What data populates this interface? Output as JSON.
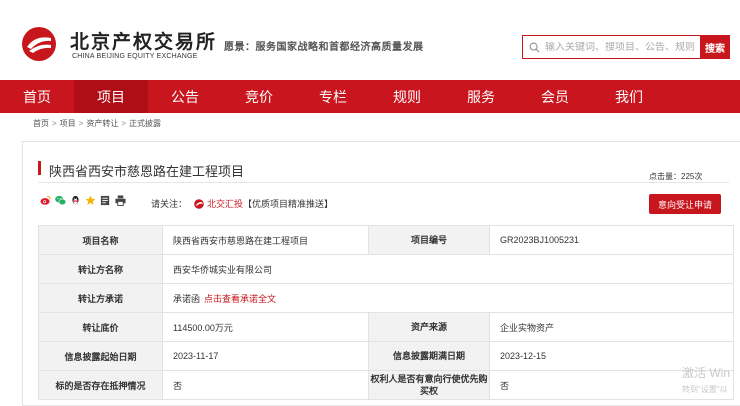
{
  "header": {
    "logo_cn": "北京产权交易所",
    "logo_en": "CHINA BEIJING EQUITY EXCHANGE",
    "tagline": "愿景：服务国家战略和首都经济高质量发展",
    "brand_color": "#c8161d"
  },
  "search": {
    "placeholder": "输入关键词、搜项目、公告、规则...",
    "button_label": "搜索"
  },
  "nav": {
    "items": [
      "首页",
      "项目",
      "公告",
      "竞价",
      "专栏",
      "规则",
      "服务",
      "会员",
      "我们"
    ],
    "active_index": 1
  },
  "breadcrumb": [
    "首页",
    "项目",
    "资产转让",
    "正式披露"
  ],
  "breadcrumb_sep": ">",
  "project": {
    "title": "陕西省西安市慈恩路在建工程项目",
    "view_count": "点击量：225次",
    "apply_label": "意向受让申请"
  },
  "share": {
    "icons": [
      "weibo-icon",
      "wechat-icon",
      "qq-icon",
      "favorite-icon",
      "edit-icon",
      "print-icon"
    ]
  },
  "follow": {
    "label": "请关注：",
    "link": "北交汇投",
    "note": "【优质项目精准推送】"
  },
  "table": {
    "r1": {
      "l1": "项目名称",
      "v1": "陕西省西安市慈恩路在建工程项目",
      "l2": "项目编号",
      "v2": "GR2023BJ1005231"
    },
    "r2": {
      "l1": "转让方名称",
      "v1": "西安华侨城实业有限公司"
    },
    "r3": {
      "l1": "转让方承诺",
      "v1": "承诺函",
      "link": "点击查看承诺全文"
    },
    "r4": {
      "l1": "转让底价",
      "v1": "114500.00万元",
      "l2": "资产来源",
      "v2": "企业实物资产"
    },
    "r5": {
      "l1": "信息披露起始日期",
      "v1": "2023-11-17",
      "l2": "信息披露期满日期",
      "v2": "2023-12-15"
    },
    "r6": {
      "l1": "标的是否存在抵押情况",
      "v1": "否",
      "l2": "权利人是否有意向行使优先购买权",
      "v2": "否"
    }
  },
  "watermark": {
    "line1": "激活 Win",
    "line2": "转到\"设置\"以"
  }
}
